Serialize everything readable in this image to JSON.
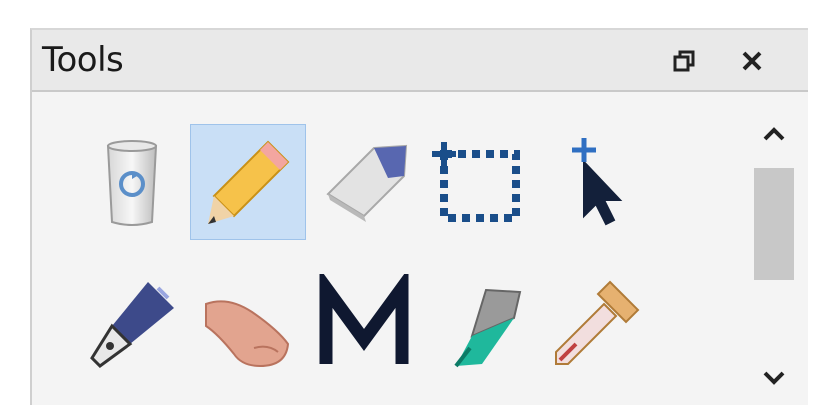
{
  "panel": {
    "title": "Tools",
    "restore_icon": "restore-icon",
    "close_icon": "close-icon"
  },
  "tools": [
    {
      "name": "recycle-bin",
      "icon": "recycle-bin-icon",
      "selected": false
    },
    {
      "name": "pencil",
      "icon": "pencil-icon",
      "selected": true
    },
    {
      "name": "eraser",
      "icon": "eraser-icon",
      "selected": false
    },
    {
      "name": "rectangle-select",
      "icon": "rectangle-select-icon",
      "selected": false
    },
    {
      "name": "pointer",
      "icon": "pointer-icon",
      "selected": false
    },
    {
      "name": "pen",
      "icon": "pen-icon",
      "selected": false
    },
    {
      "name": "finger-smudge",
      "icon": "finger-smudge-icon",
      "selected": false
    },
    {
      "name": "m-letter",
      "icon": "m-letter-icon",
      "selected": false
    },
    {
      "name": "marker",
      "icon": "marker-icon",
      "selected": false
    },
    {
      "name": "dropper",
      "icon": "dropper-icon",
      "selected": false
    }
  ],
  "scrollbar": {
    "up_icon": "chevron-up-icon",
    "down_icon": "chevron-down-icon"
  },
  "colors": {
    "selection": "#c9dff6",
    "titlebar": "#e9e9e9"
  }
}
